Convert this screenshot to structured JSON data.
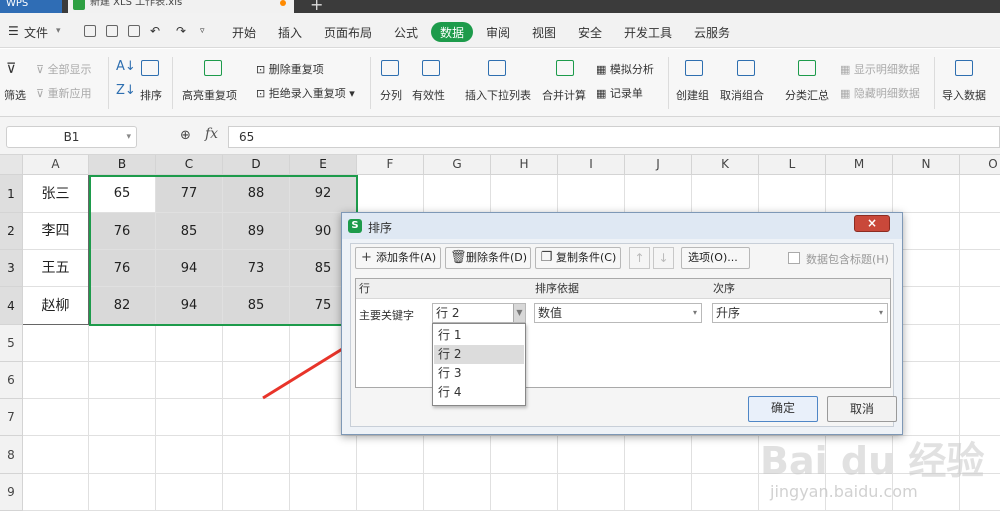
{
  "titlebar": {
    "app": "WPS",
    "document": "新建 XLS 工作表.xls"
  },
  "menubar": {
    "file": "文件",
    "tabs": [
      "开始",
      "插入",
      "页面布局",
      "公式",
      "数据",
      "审阅",
      "视图",
      "安全",
      "开发工具",
      "云服务"
    ],
    "active_tab": "数据"
  },
  "ribbon": {
    "filter": "筛选",
    "show_all": "全部显示",
    "reapply": "重新应用",
    "sort": "排序",
    "highlight_dup": "高亮重复项",
    "remove_dup": "删除重复项",
    "reject_dup": "拒绝录入重复项",
    "split": "分列",
    "validity": "有效性",
    "insert_dropdown": "插入下拉列表",
    "merge_calc": "合并计算",
    "simulate": "模拟分析",
    "record": "记录单",
    "create_group": "创建组",
    "ungroup": "取消组合",
    "subtotal": "分类汇总",
    "show_detail": "显示明细数据",
    "hide_detail": "隐藏明细数据",
    "import": "导入数据"
  },
  "formula_bar": {
    "cell_ref": "B1",
    "fx": "fx",
    "value": "65"
  },
  "grid": {
    "columns": [
      "A",
      "B",
      "C",
      "D",
      "E",
      "F",
      "G",
      "H",
      "I",
      "J",
      "K",
      "L",
      "M",
      "N",
      "O"
    ],
    "rows": [
      "1",
      "2",
      "3",
      "4",
      "5",
      "6",
      "7",
      "8",
      "9"
    ],
    "data": [
      [
        "张三",
        "65",
        "77",
        "88",
        "92"
      ],
      [
        "李四",
        "76",
        "85",
        "89",
        "90"
      ],
      [
        "王五",
        "76",
        "94",
        "73",
        "85"
      ],
      [
        "赵柳",
        "82",
        "94",
        "85",
        "75"
      ]
    ]
  },
  "dialog": {
    "title": "排序",
    "close": "×",
    "add_condition": "添加条件(A)",
    "delete_condition": "删除条件(D)",
    "copy_condition": "复制条件(C)",
    "up": "↑",
    "down": "↓",
    "options": "选项(O)...",
    "has_header": "数据包含标题(H)",
    "headers": {
      "col1": "行",
      "col2": "排序依据",
      "col3": "次序"
    },
    "primary_key_label": "主要关键字",
    "primary_key_value": "行 2",
    "sort_on": "数值",
    "order": "升序",
    "dropdown_options": [
      "行 1",
      "行 2",
      "行 3",
      "行 4"
    ],
    "ok": "确定",
    "cancel": "取消"
  },
  "watermark": {
    "brand": "Bai du 经验",
    "url": "jingyan.baidu.com"
  },
  "colors": {
    "accent": "#1d9b4b",
    "selection": "#1d9b4b",
    "arrow": "#e8342a"
  }
}
